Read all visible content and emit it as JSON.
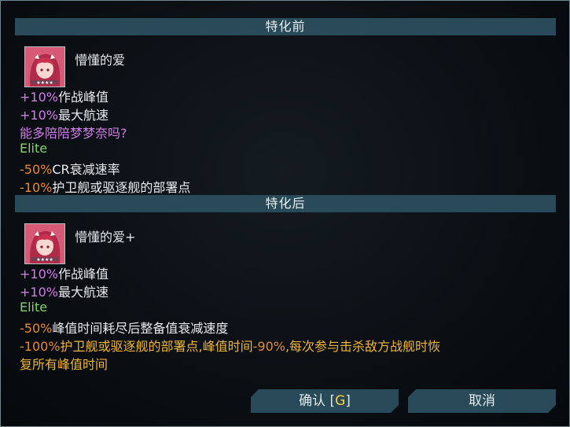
{
  "before": {
    "header": "特化前",
    "name": "懵懂的爱",
    "icon": "pink-hair-character-portrait",
    "lines": [
      {
        "value": "+10%",
        "text": "作战峰值"
      },
      {
        "value": "+10%",
        "text": "最大航速"
      }
    ],
    "question": "能多陪陪梦梦奈吗?",
    "elite_label": "Elite",
    "elite_lines": [
      {
        "value": "-50%",
        "text": "CR衰减速率"
      },
      {
        "value": "-10%",
        "text": "护卫舰或驱逐舰的部署点"
      }
    ]
  },
  "after": {
    "header": "特化后",
    "name": "懵懂的爱+",
    "icon": "pink-hair-character-portrait",
    "lines": [
      {
        "value": "+10%",
        "text": "作战峰值"
      },
      {
        "value": "+10%",
        "text": "最大航速"
      }
    ],
    "elite_label": "Elite",
    "elite_lines": [
      {
        "value": "-50%",
        "text": "峰值时间耗尽后整备值衰减速度"
      }
    ],
    "last": {
      "value1": "-100%",
      "text1": "护卫舰或驱逐舰的部署点,峰值时间",
      "value2": "-90%",
      "text2": ",每次参与击杀敌方战舰时恢",
      "text3": "复所有峰值时间"
    }
  },
  "buttons": {
    "confirm_label": "确认 [",
    "confirm_hotkey": "G",
    "confirm_close": "]",
    "cancel_label": "取消"
  },
  "colors": {
    "header_bg": "#294a58",
    "positive": "#d27de6",
    "elite": "#83d36a",
    "negative": "#e58a39",
    "highlight": "#efb43a"
  }
}
